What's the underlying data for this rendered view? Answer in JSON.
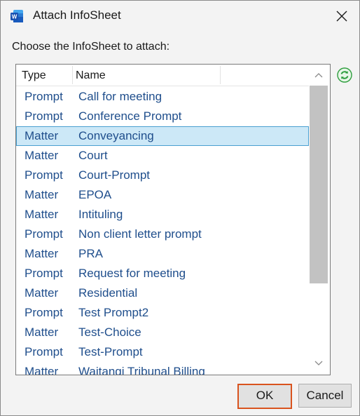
{
  "dialog": {
    "title": "Attach InfoSheet",
    "prompt": "Choose the InfoSheet to attach:",
    "app_icon": "word-icon",
    "close_icon": "close-icon",
    "refresh_icon": "refresh-icon"
  },
  "list": {
    "columns": [
      "Type",
      "Name"
    ],
    "selected_index": 2,
    "rows": [
      {
        "type": "Prompt",
        "name": "Call for meeting"
      },
      {
        "type": "Prompt",
        "name": "Conference Prompt"
      },
      {
        "type": "Matter",
        "name": "Conveyancing"
      },
      {
        "type": "Matter",
        "name": "Court"
      },
      {
        "type": "Prompt",
        "name": "Court-Prompt"
      },
      {
        "type": "Matter",
        "name": "EPOA"
      },
      {
        "type": "Matter",
        "name": "Intituling"
      },
      {
        "type": "Prompt",
        "name": "Non client letter prompt"
      },
      {
        "type": "Matter",
        "name": "PRA"
      },
      {
        "type": "Prompt",
        "name": "Request for meeting"
      },
      {
        "type": "Matter",
        "name": "Residential"
      },
      {
        "type": "Prompt",
        "name": "Test Prompt2"
      },
      {
        "type": "Matter",
        "name": "Test-Choice"
      },
      {
        "type": "Prompt",
        "name": "Test-Prompt"
      },
      {
        "type": "Matter",
        "name": "Waitangi Tribunal Billing"
      }
    ]
  },
  "buttons": {
    "ok": "OK",
    "cancel": "Cancel"
  },
  "colors": {
    "accent_focus": "#d9531e",
    "selection_bg": "#cce8f7",
    "row_text": "#1f4e8c"
  }
}
